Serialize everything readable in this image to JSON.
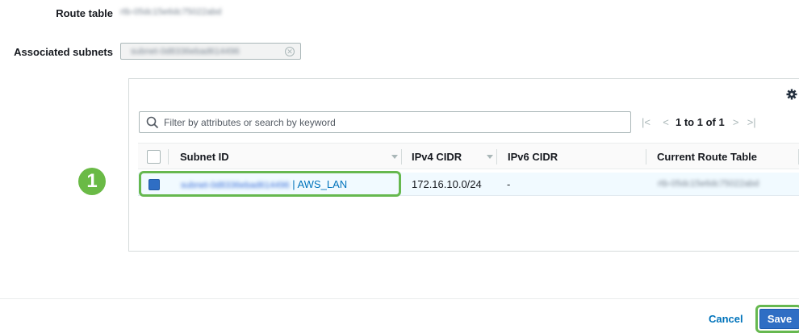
{
  "form": {
    "route_table_label": "Route table",
    "route_table_value": "rtb-05dc15e6dc75022abd",
    "associated_subnets_label": "Associated subnets",
    "associated_subnet_chip": "subnet-0d8336ebad614496"
  },
  "table": {
    "filter_placeholder": "Filter by attributes or search by keyword",
    "pagination": {
      "range": "1 to 1 of 1"
    },
    "columns": [
      "Subnet ID",
      "IPv4 CIDR",
      "IPv6 CIDR",
      "Current Route Table"
    ],
    "rows": [
      {
        "subnet_id": "subnet-0d8336ebad614496",
        "subnet_name": "| AWS_LAN",
        "ipv4_cidr": "172.16.10.0/24",
        "ipv6_cidr": "-",
        "current_route_table": "rtb-05dc15e6dc75022abd",
        "selected": true
      }
    ]
  },
  "annotation": {
    "step_number": "1",
    "color": "#6aba46"
  },
  "footer": {
    "cancel_label": "Cancel",
    "save_label": "Save"
  },
  "colors": {
    "accent": "#2f6ec4",
    "link": "#0073bb",
    "highlight": "#66b84f"
  }
}
